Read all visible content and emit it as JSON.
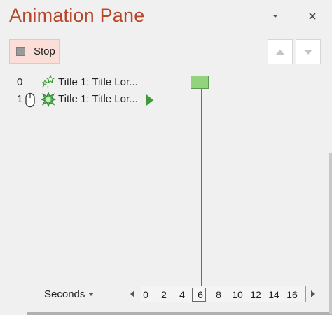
{
  "pane": {
    "title": "Animation Pane",
    "header_icons": [
      "chevron-down-icon",
      "close-icon"
    ]
  },
  "toolbar": {
    "stop_label": "Stop",
    "move_up_icon": "triangle-up-icon",
    "move_down_icon": "triangle-down-icon"
  },
  "animations": [
    {
      "number": "0",
      "label": "Title 1: Title Lor...",
      "trigger_icon": "",
      "effect_icon": "entrance-sparkle-icon"
    },
    {
      "number": "1",
      "label": "Title 1: Title Lor...",
      "trigger_icon": "mouse-icon",
      "effect_icon": "starburst-effect-icon"
    }
  ],
  "timeline": {
    "seconds_label": "Seconds",
    "ticks": [
      "0",
      "2",
      "4",
      "6",
      "8",
      "10",
      "12",
      "14",
      "16"
    ],
    "current_tick": "6"
  },
  "colors": {
    "title": "#b7472a",
    "stop_bg": "#fbded8",
    "timing_bar": "#92d47e",
    "effect_green": "#3f9b3a"
  }
}
